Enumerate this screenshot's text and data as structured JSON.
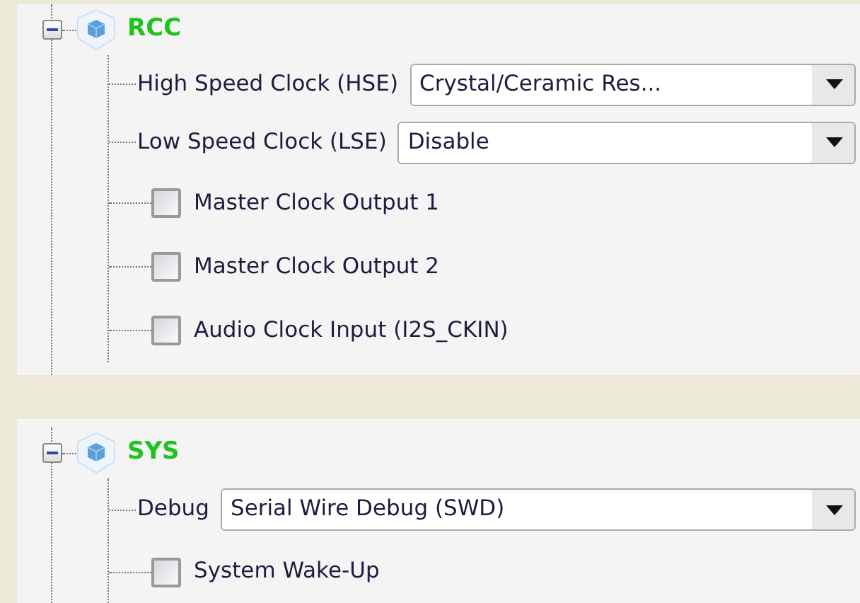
{
  "groups": [
    {
      "title": "RCC",
      "expanded": true,
      "children": [
        {
          "kind": "select",
          "label": "High Speed Clock (HSE)",
          "value": "Crystal/Ceramic Res..."
        },
        {
          "kind": "select",
          "label": "Low Speed Clock (LSE)",
          "value": "Disable"
        },
        {
          "kind": "checkbox",
          "label": "Master Clock Output 1",
          "checked": false
        },
        {
          "kind": "checkbox",
          "label": "Master Clock Output 2",
          "checked": false
        },
        {
          "kind": "checkbox",
          "label": "Audio Clock Input (I2S_CKIN)",
          "checked": false
        }
      ]
    },
    {
      "title": "SYS",
      "expanded": true,
      "children": [
        {
          "kind": "select",
          "label": "Debug",
          "value": "Serial Wire Debug (SWD)"
        },
        {
          "kind": "checkbox",
          "label": "System Wake-Up",
          "checked": false
        }
      ]
    }
  ]
}
